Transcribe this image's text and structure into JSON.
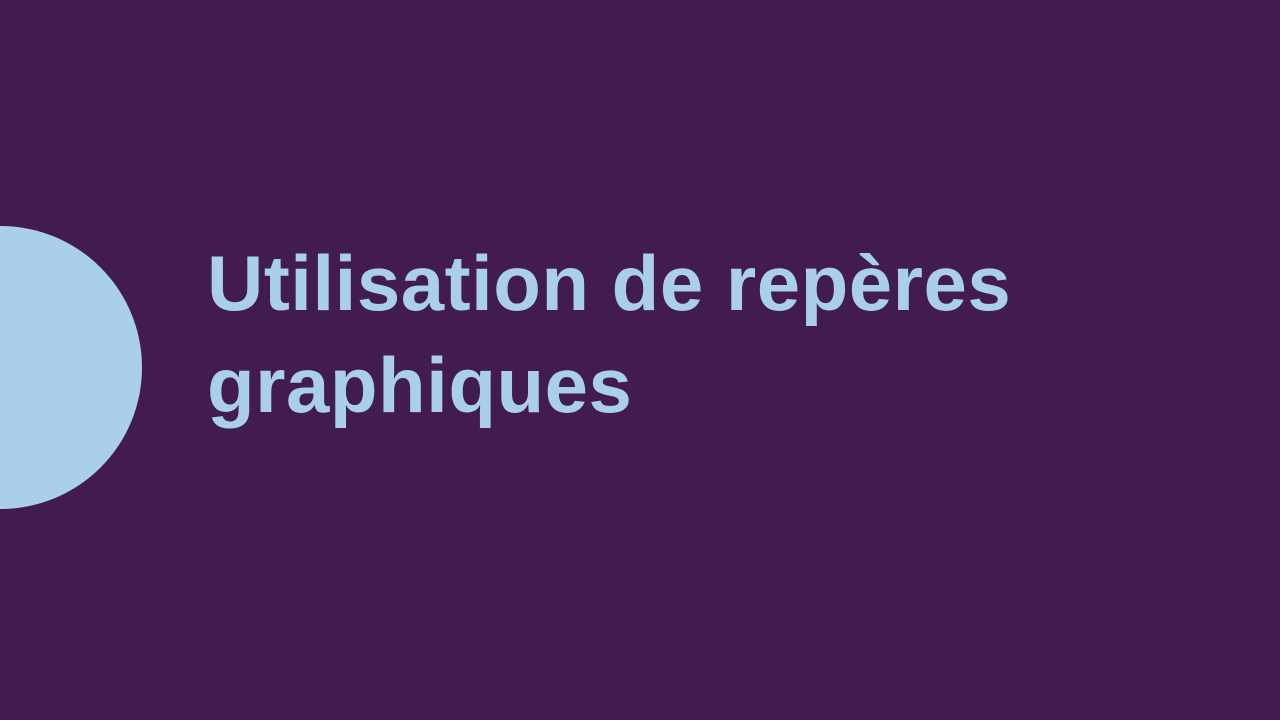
{
  "slide": {
    "title_lines": [
      "Utilisation de repères",
      "graphiques"
    ]
  },
  "colors": {
    "background": "#411b51",
    "accent": "#a9cfeb",
    "title_text": "#a9cfeb"
  }
}
